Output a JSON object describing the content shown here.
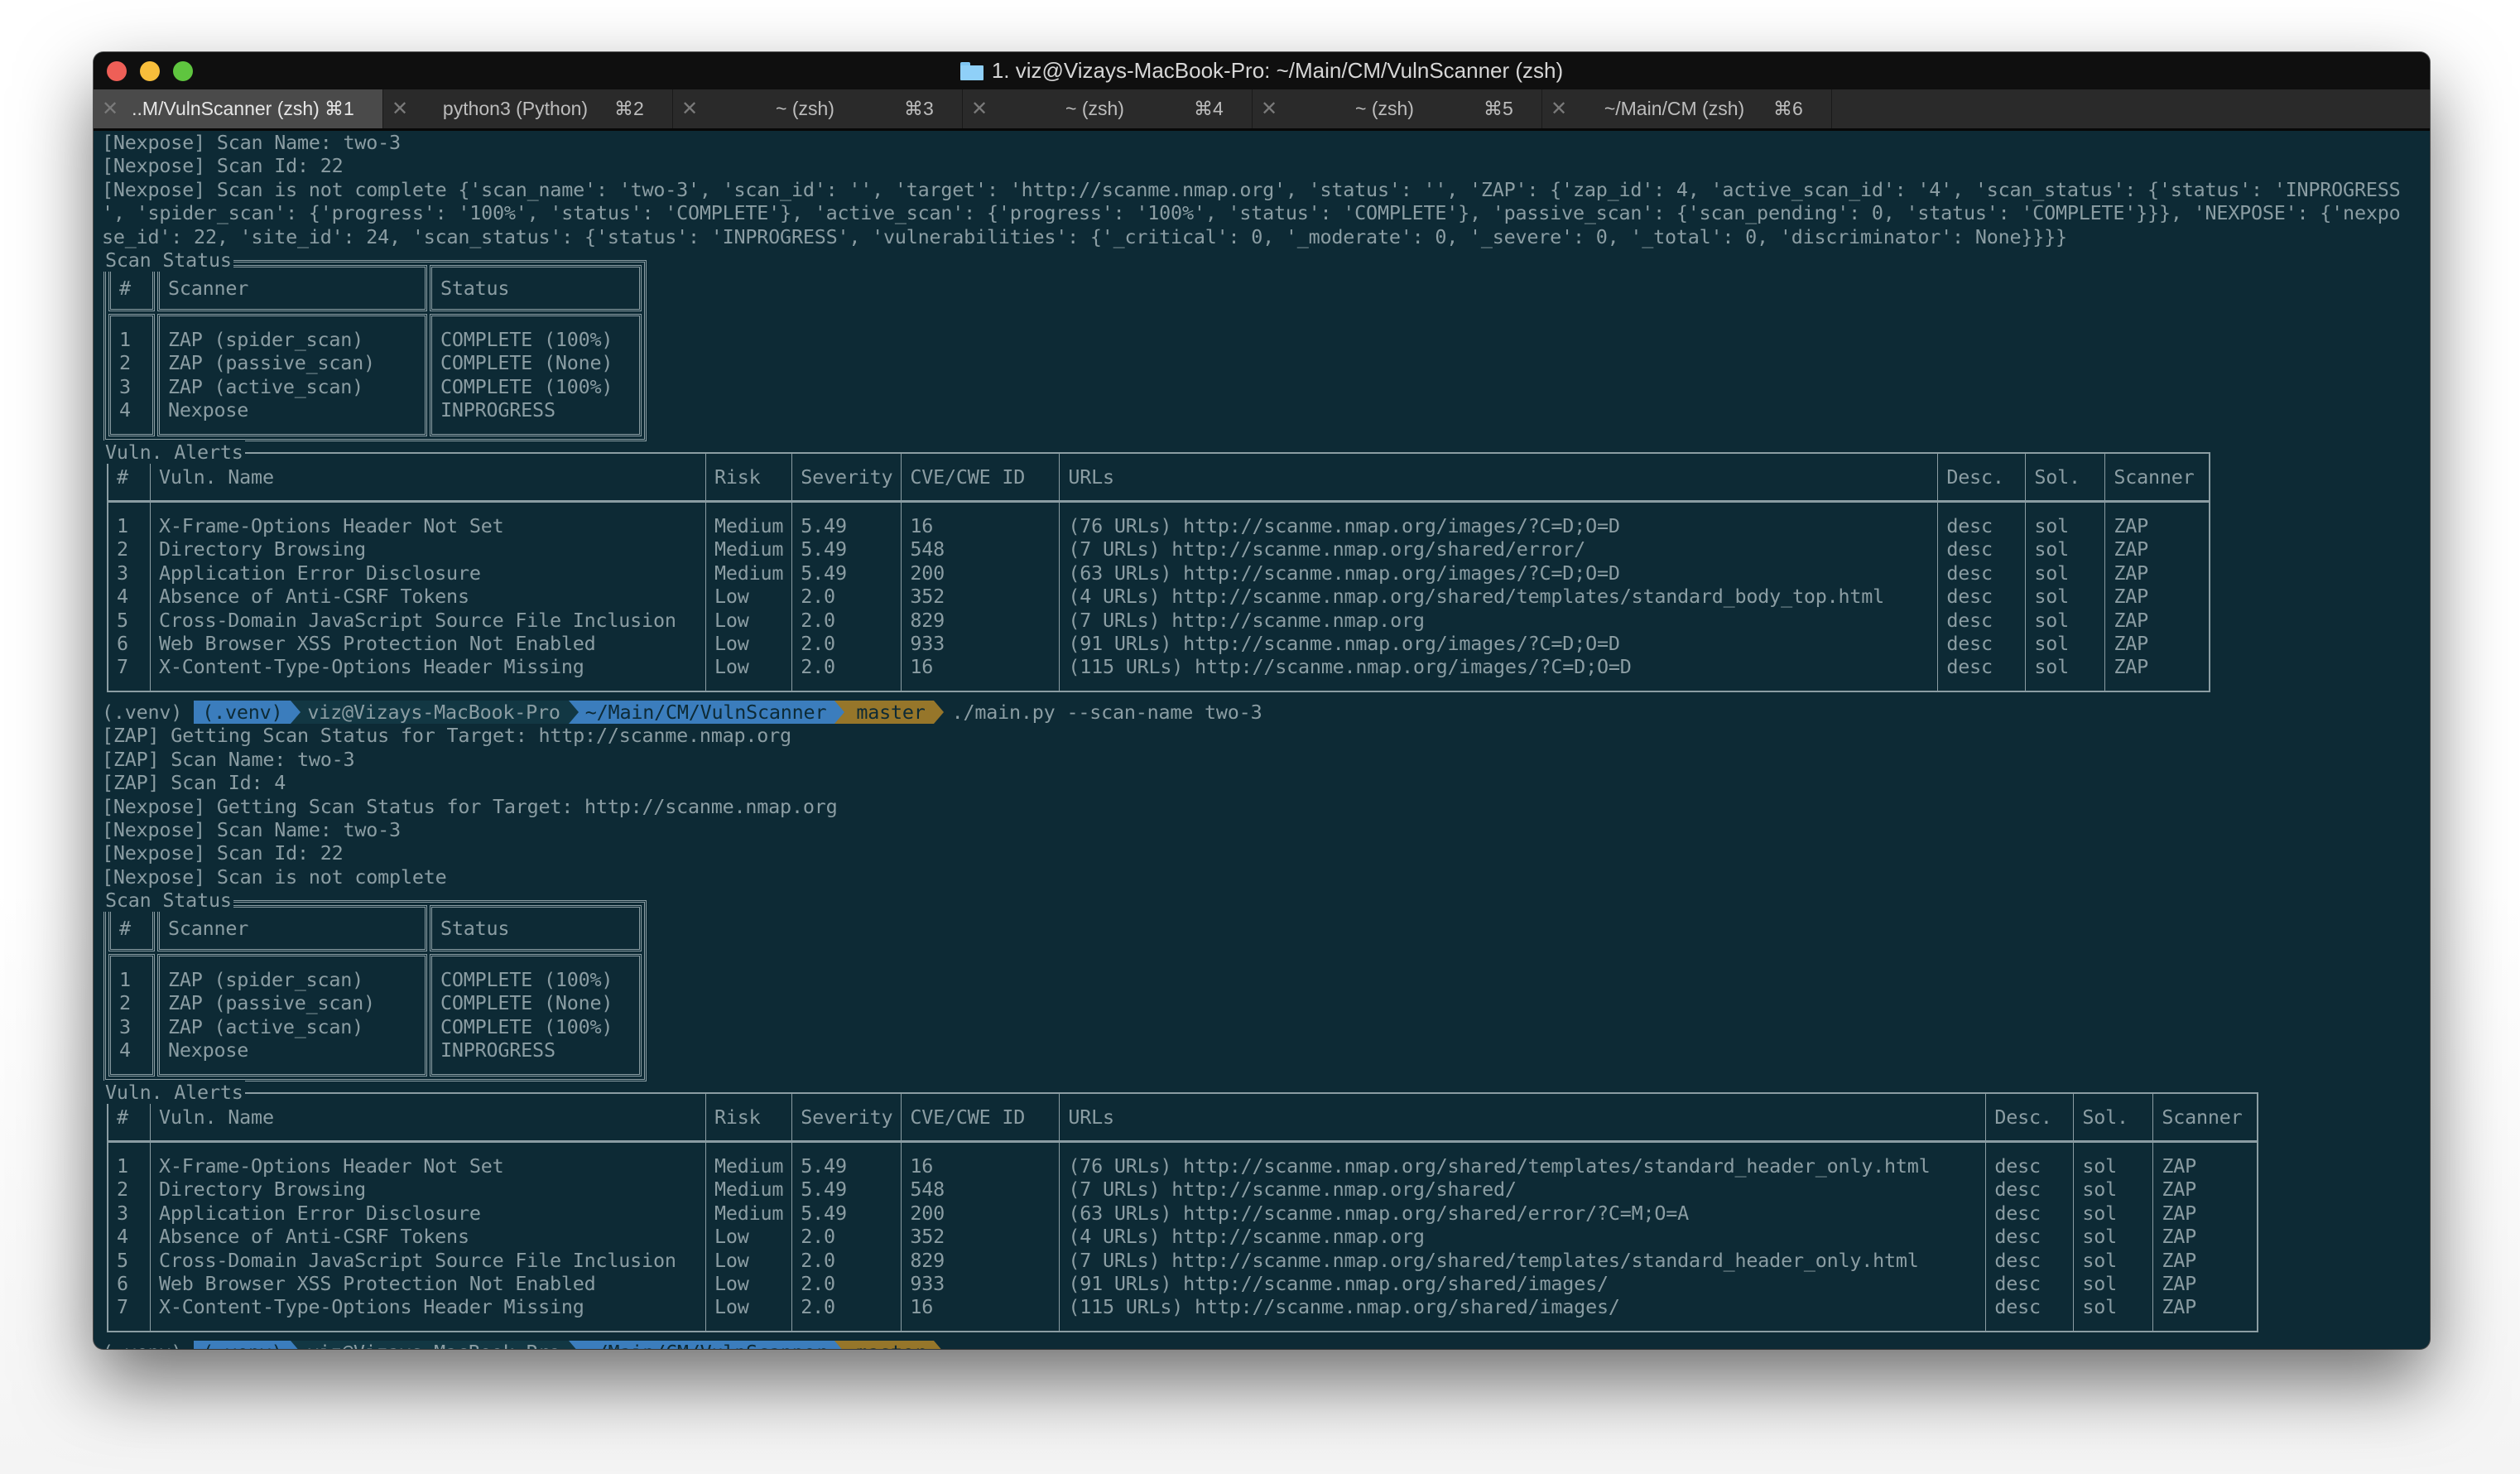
{
  "window": {
    "title": "1. viz@Vizays-MacBook-Pro: ~/Main/CM/VulnScanner (zsh)",
    "title_icon": "folder-icon",
    "tabs": [
      {
        "label": "..M/VulnScanner (zsh)",
        "shortcut": "⌘1",
        "active": true
      },
      {
        "label": "python3 (Python)",
        "shortcut": "⌘2",
        "active": false
      },
      {
        "label": "~ (zsh)",
        "shortcut": "⌘3",
        "active": false
      },
      {
        "label": "~ (zsh)",
        "shortcut": "⌘4",
        "active": false
      },
      {
        "label": "~ (zsh)",
        "shortcut": "⌘5",
        "active": false
      },
      {
        "label": "~/Main/CM (zsh)",
        "shortcut": "⌘6",
        "active": false
      }
    ],
    "tab_close_glyph": "✕"
  },
  "colors": {
    "terminal_bg": "#0d2a35",
    "terminal_fg": "#8b9da3",
    "prompt_blue": "#3b7dbd",
    "prompt_dark": "#123743",
    "prompt_gold": "#96762a"
  },
  "run1": {
    "pre_lines": [
      "[Nexpose] Scan Name: two-3",
      "[Nexpose] Scan Id: 22",
      "[Nexpose] Scan is not complete {'scan_name': 'two-3', 'scan_id': '', 'target': 'http://scanme.nmap.org', 'status': '', 'ZAP': {'zap_id': 4, 'active_scan_id': '4', 'scan_status': {'status': 'INPROGRESS",
      "', 'spider_scan': {'progress': '100%', 'status': 'COMPLETE'}, 'active_scan': {'progress': '100%', 'status': 'COMPLETE'}, 'passive_scan': {'scan_pending': 0, 'status': 'COMPLETE'}}}, 'NEXPOSE': {'nexpo",
      "se_id': 22, 'site_id': 24, 'scan_status': {'status': 'INPROGRESS', 'vulnerabilities': {'_critical': 0, '_moderate': 0, '_severe': 0, '_total': 0, 'discriminator': None}}}}"
    ],
    "scan_status": {
      "title": "Scan Status",
      "headers": [
        "#",
        "Scanner",
        "Status"
      ],
      "rows": [
        [
          "1",
          "ZAP (spider_scan)",
          "COMPLETE (100%)"
        ],
        [
          "2",
          "ZAP (passive_scan)",
          "COMPLETE (None)"
        ],
        [
          "3",
          "ZAP (active_scan)",
          "COMPLETE (100%)"
        ],
        [
          "4",
          "Nexpose",
          "INPROGRESS"
        ]
      ]
    },
    "vuln_alerts": {
      "title": "Vuln. Alerts",
      "headers": [
        "#",
        "Vuln. Name",
        "Risk",
        "Severity",
        "CVE/CWE ID",
        "URLs",
        "Desc.",
        "Sol.",
        "Scanner"
      ],
      "rows": [
        [
          "1",
          "X-Frame-Options Header Not Set",
          "Medium",
          "5.49",
          "16",
          "(76 URLs) http://scanme.nmap.org/images/?C=D;O=D",
          "desc",
          "sol",
          "ZAP"
        ],
        [
          "2",
          "Directory Browsing",
          "Medium",
          "5.49",
          "548",
          "(7 URLs) http://scanme.nmap.org/shared/error/",
          "desc",
          "sol",
          "ZAP"
        ],
        [
          "3",
          "Application Error Disclosure",
          "Medium",
          "5.49",
          "200",
          "(63 URLs) http://scanme.nmap.org/images/?C=D;O=D",
          "desc",
          "sol",
          "ZAP"
        ],
        [
          "4",
          "Absence of Anti-CSRF Tokens",
          "Low",
          "2.0",
          "352",
          "(4 URLs) http://scanme.nmap.org/shared/templates/standard_body_top.html",
          "desc",
          "sol",
          "ZAP"
        ],
        [
          "5",
          "Cross-Domain JavaScript Source File Inclusion",
          "Low",
          "2.0",
          "829",
          "(7 URLs) http://scanme.nmap.org",
          "desc",
          "sol",
          "ZAP"
        ],
        [
          "6",
          "Web Browser XSS Protection Not Enabled",
          "Low",
          "2.0",
          "933",
          "(91 URLs) http://scanme.nmap.org/images/?C=D;O=D",
          "desc",
          "sol",
          "ZAP"
        ],
        [
          "7",
          "X-Content-Type-Options Header Missing",
          "Low",
          "2.0",
          "16",
          "(115 URLs) http://scanme.nmap.org/images/?C=D;O=D",
          "desc",
          "sol",
          "ZAP"
        ]
      ]
    }
  },
  "prompt": {
    "venv_plain": "(.venv)",
    "venv_segment": "(.venv)",
    "host": "viz@Vizays-MacBook-Pro",
    "path": "~/Main/CM/VulnScanner",
    "branch_icon": "git-branch-icon",
    "branch_glyph": "",
    "branch": "master"
  },
  "command": "./main.py --scan-name two-3",
  "run2": {
    "pre_lines": [
      "[ZAP] Getting Scan Status for Target: http://scanme.nmap.org",
      "[ZAP] Scan Name: two-3",
      "[ZAP] Scan Id: 4",
      "[Nexpose] Getting Scan Status for Target: http://scanme.nmap.org",
      "[Nexpose] Scan Name: two-3",
      "[Nexpose] Scan Id: 22",
      "[Nexpose] Scan is not complete"
    ],
    "scan_status": {
      "title": "Scan Status",
      "headers": [
        "#",
        "Scanner",
        "Status"
      ],
      "rows": [
        [
          "1",
          "ZAP (spider_scan)",
          "COMPLETE (100%)"
        ],
        [
          "2",
          "ZAP (passive_scan)",
          "COMPLETE (None)"
        ],
        [
          "3",
          "ZAP (active_scan)",
          "COMPLETE (100%)"
        ],
        [
          "4",
          "Nexpose",
          "INPROGRESS"
        ]
      ]
    },
    "vuln_alerts": {
      "title": "Vuln. Alerts",
      "headers": [
        "#",
        "Vuln. Name",
        "Risk",
        "Severity",
        "CVE/CWE ID",
        "URLs",
        "Desc.",
        "Sol.",
        "Scanner"
      ],
      "rows": [
        [
          "1",
          "X-Frame-Options Header Not Set",
          "Medium",
          "5.49",
          "16",
          "(76 URLs) http://scanme.nmap.org/shared/templates/standard_header_only.html",
          "desc",
          "sol",
          "ZAP"
        ],
        [
          "2",
          "Directory Browsing",
          "Medium",
          "5.49",
          "548",
          "(7 URLs) http://scanme.nmap.org/shared/",
          "desc",
          "sol",
          "ZAP"
        ],
        [
          "3",
          "Application Error Disclosure",
          "Medium",
          "5.49",
          "200",
          "(63 URLs) http://scanme.nmap.org/shared/error/?C=M;O=A",
          "desc",
          "sol",
          "ZAP"
        ],
        [
          "4",
          "Absence of Anti-CSRF Tokens",
          "Low",
          "2.0",
          "352",
          "(4 URLs) http://scanme.nmap.org",
          "desc",
          "sol",
          "ZAP"
        ],
        [
          "5",
          "Cross-Domain JavaScript Source File Inclusion",
          "Low",
          "2.0",
          "829",
          "(7 URLs) http://scanme.nmap.org/shared/templates/standard_header_only.html",
          "desc",
          "sol",
          "ZAP"
        ],
        [
          "6",
          "Web Browser XSS Protection Not Enabled",
          "Low",
          "2.0",
          "933",
          "(91 URLs) http://scanme.nmap.org/shared/images/",
          "desc",
          "sol",
          "ZAP"
        ],
        [
          "7",
          "X-Content-Type-Options Header Missing",
          "Low",
          "2.0",
          "16",
          "(115 URLs) http://scanme.nmap.org/shared/images/",
          "desc",
          "sol",
          "ZAP"
        ]
      ]
    }
  }
}
